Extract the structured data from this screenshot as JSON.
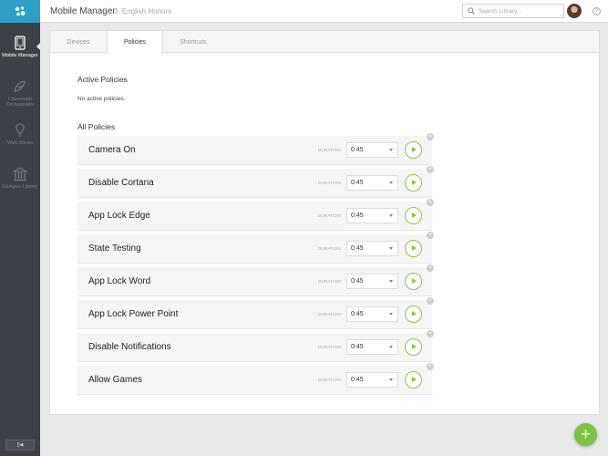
{
  "topbar": {
    "app_title": "Mobile Manager",
    "separator": "\\",
    "class_name": "3. English Honors",
    "search_placeholder": "Search Library...",
    "help": "?"
  },
  "sidebar": {
    "items": [
      {
        "label": "Mobile Manager",
        "icon": "tablet-icon",
        "active": true
      },
      {
        "label": "Classroom Orchestrator",
        "icon": "feather-icon",
        "active": false
      },
      {
        "label": "Web Zones",
        "icon": "map-pin-icon",
        "active": false
      },
      {
        "label": "Campus Library",
        "icon": "library-icon",
        "active": false
      }
    ],
    "bottom_label": "[]◀"
  },
  "tabs": [
    {
      "label": "Devices",
      "active": false
    },
    {
      "label": "Policies",
      "active": true
    },
    {
      "label": "Shortcuts",
      "active": false
    }
  ],
  "active_policies": {
    "title": "Active Policies",
    "empty_text": "No active policies."
  },
  "all_policies": {
    "title": "All Policies",
    "duration_label": "DURATION:",
    "items": [
      {
        "name": "Camera On",
        "duration": "0:45"
      },
      {
        "name": "Disable Cortana",
        "duration": "0:45"
      },
      {
        "name": "App Lock Edge",
        "duration": "0:45"
      },
      {
        "name": "State Testing",
        "duration": "0:45"
      },
      {
        "name": "App Lock Word",
        "duration": "0:45"
      },
      {
        "name": "App Lock Power Point",
        "duration": "0:45"
      },
      {
        "name": "Disable Notifications",
        "duration": "0:45"
      },
      {
        "name": "Allow Games",
        "duration": "0:45"
      }
    ]
  },
  "fab_label": "+",
  "colors": {
    "accent": "#7cc243",
    "sidebar": "#3c4148",
    "logo": "#2d9fc9"
  }
}
